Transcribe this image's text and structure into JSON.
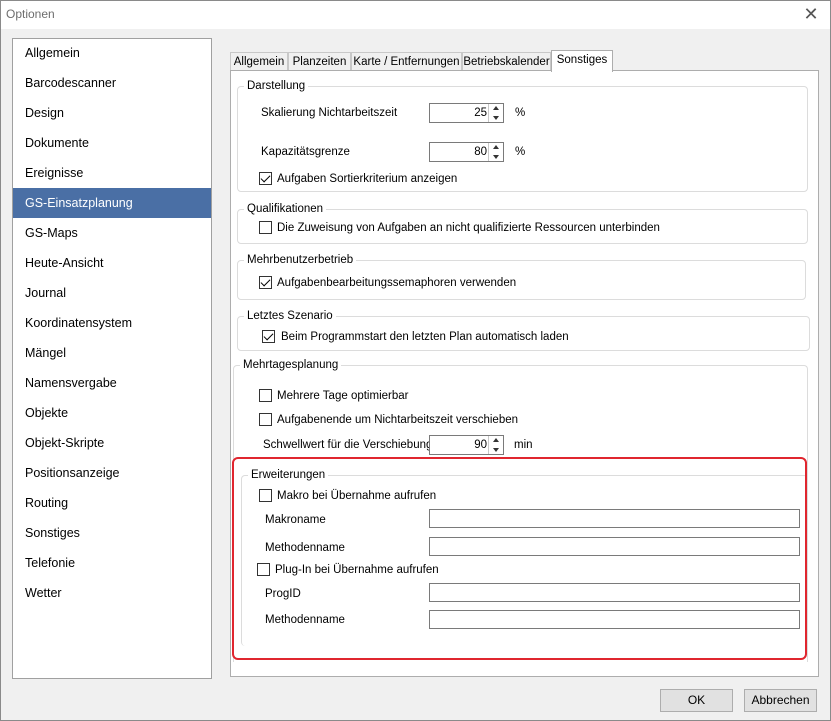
{
  "window": {
    "title": "Optionen"
  },
  "sidebar": {
    "items": [
      {
        "label": "Allgemein"
      },
      {
        "label": "Barcodescanner"
      },
      {
        "label": "Design"
      },
      {
        "label": "Dokumente"
      },
      {
        "label": "Ereignisse"
      },
      {
        "label": "GS-Einsatzplanung",
        "selected": true
      },
      {
        "label": "GS-Maps"
      },
      {
        "label": "Heute-Ansicht"
      },
      {
        "label": "Journal"
      },
      {
        "label": "Koordinatensystem"
      },
      {
        "label": "Mängel"
      },
      {
        "label": "Namensvergabe"
      },
      {
        "label": "Objekte"
      },
      {
        "label": "Objekt-Skripte"
      },
      {
        "label": "Positionsanzeige"
      },
      {
        "label": "Routing"
      },
      {
        "label": "Sonstiges"
      },
      {
        "label": "Telefonie"
      },
      {
        "label": "Wetter"
      }
    ]
  },
  "tabs": [
    {
      "label": "Allgemein"
    },
    {
      "label": "Planzeiten"
    },
    {
      "label": "Karte / Entfernungen"
    },
    {
      "label": "Betriebskalender"
    },
    {
      "label": "Sonstiges",
      "active": true
    }
  ],
  "darstellung": {
    "title": "Darstellung",
    "skalierung_label": "Skalierung Nichtarbeitszeit",
    "skalierung_value": "25",
    "skalierung_unit": "%",
    "kapazitaet_label": "Kapazitätsgrenze",
    "kapazitaet_value": "80",
    "kapazitaet_unit": "%",
    "sortier_label": "Aufgaben Sortierkriterium anzeigen",
    "sortier_checked": true
  },
  "qualifikationen": {
    "title": "Qualifikationen",
    "zuweisung_label": "Die Zuweisung von Aufgaben an nicht qualifizierte Ressourcen unterbinden",
    "zuweisung_checked": false
  },
  "mehrbenutzer": {
    "title": "Mehrbenutzerbetrieb",
    "semaphoren_label": "Aufgabenbearbeitungssemaphoren verwenden",
    "semaphoren_checked": true
  },
  "letztes_szenario": {
    "title": "Letztes Szenario",
    "laden_label": "Beim Programmstart den letzten Plan automatisch laden",
    "laden_checked": true
  },
  "mehrtages": {
    "title": "Mehrtagesplanung",
    "optimierbar_label": "Mehrere Tage optimierbar",
    "optimierbar_checked": false,
    "verschieben_label": "Aufgabenende um Nichtarbeitszeit verschieben",
    "verschieben_checked": false,
    "schwellwert_label": "Schwellwert für die Verschiebung",
    "schwellwert_value": "90",
    "schwellwert_unit": "min"
  },
  "erweiterungen": {
    "title": "Erweiterungen",
    "makro_label": "Makro bei Übernahme aufrufen",
    "makro_checked": false,
    "makroname_label": "Makroname",
    "makroname_value": "",
    "methodenname1_label": "Methodenname",
    "methodenname1_value": "",
    "plugin_label": "Plug-In bei Übernahme aufrufen",
    "plugin_checked": false,
    "progid_label": "ProgID",
    "progid_value": "",
    "methodenname2_label": "Methodenname",
    "methodenname2_value": ""
  },
  "buttons": {
    "ok": "OK",
    "cancel": "Abbrechen"
  },
  "colors": {
    "selection": "#4a6fa5",
    "highlight": "#e0262f"
  }
}
